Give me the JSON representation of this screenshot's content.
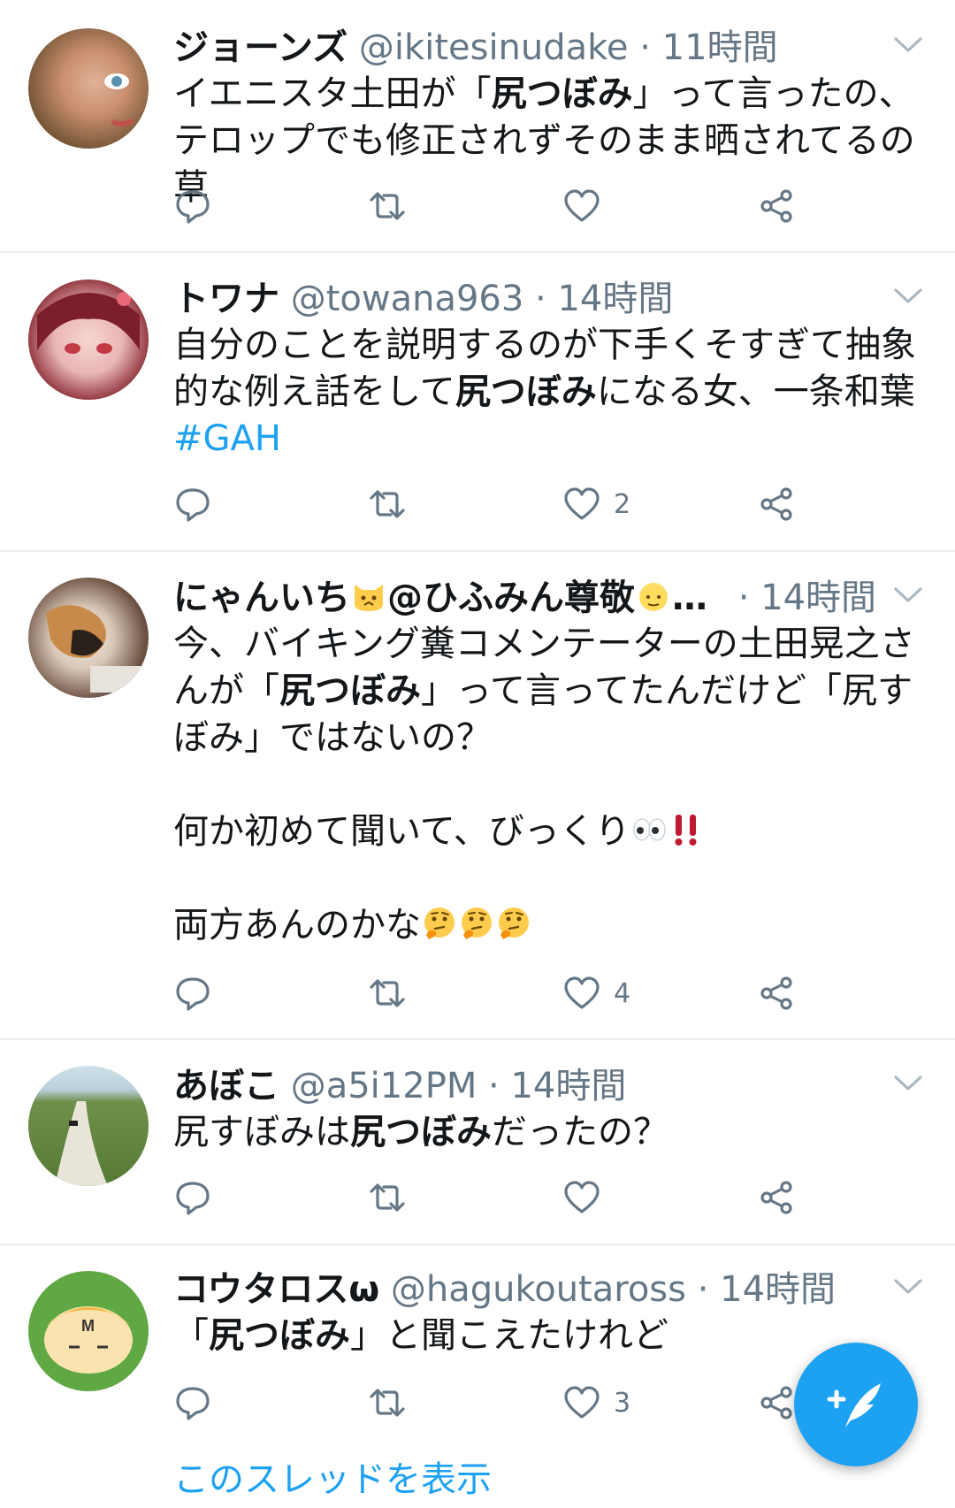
{
  "colors": {
    "accent": "#1da1f2",
    "muted": "#657786",
    "text": "#14171a",
    "divider": "#e6ecf0"
  },
  "icons": {
    "reply": "reply-icon",
    "retweet": "retweet-icon",
    "like": "heart-icon",
    "share": "share-icon",
    "compose": "compose-tweet-icon"
  },
  "tweets": [
    {
      "name": "ジョーンズ",
      "handle": "@ikitesinudake",
      "dot": "·",
      "time": "11時間",
      "text_a": "イエニスタ土田が「",
      "text_b": "尻つぼみ",
      "text_c": "」って言ったの、テロップでも修正されずそのまま晒されてるの草",
      "likes": ""
    },
    {
      "name": "トワナ",
      "handle": "@towana963",
      "dot": "·",
      "time": "14時間",
      "text_a": "自分のことを説明するのが下手くそすぎて抽象的な例え話をして",
      "text_b": "尻つぼみ",
      "text_c": "になる女、一条和葉",
      "hashtag": "#GAH",
      "likes": "2"
    },
    {
      "name": "にゃんいち",
      "name_suffix": "@ひふみん尊敬",
      "ellipsis": "…",
      "dot": "·",
      "time": "14時間",
      "text_a": "今、バイキング糞コメンテーターの土田晃之さんが「",
      "text_b": "尻つぼみ",
      "text_c": "」って言ってたんだけど「尻すぼみ」ではないの？",
      "text_d": "何か初めて聞いて、びっくり",
      "text_e": "両方あんのかな",
      "likes": "4"
    },
    {
      "name": "あぼこ",
      "handle": "@a5i12PM",
      "dot": "·",
      "time": "14時間",
      "text_a": "尻すぼみは",
      "text_b": "尻つぼみ",
      "text_c": "だったの？",
      "likes": ""
    },
    {
      "name": "コウタロスω",
      "handle": "@hagukoutaross",
      "dot": "·",
      "time": "14時間",
      "text_a": "「",
      "text_b": "尻つぼみ",
      "text_c": "」と聞こえたけれど",
      "likes": "3"
    }
  ],
  "thread_link": "このスレッドを表示"
}
